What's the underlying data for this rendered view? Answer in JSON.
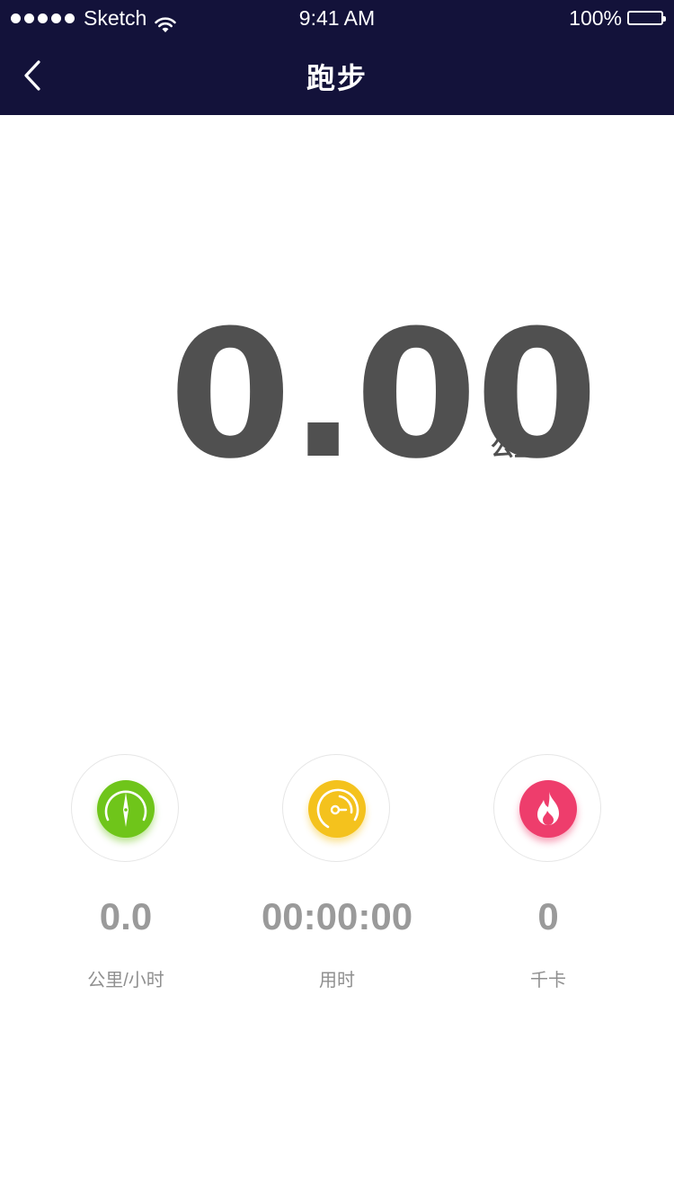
{
  "status_bar": {
    "carrier": "Sketch",
    "time": "9:41 AM",
    "battery": "100%",
    "signal_dots": 5
  },
  "nav": {
    "title": "跑步",
    "back_icon": "chevron-left-icon"
  },
  "distance": {
    "value": "0.00",
    "unit": "公里"
  },
  "stats": [
    {
      "value": "0.0",
      "label": "公里/小时",
      "icon": "compass-icon",
      "color": "#6fc51a"
    },
    {
      "value": "00:00:00",
      "label": "用时",
      "icon": "speedometer-icon",
      "color": "#f4c21d"
    },
    {
      "value": "0",
      "label": "千卡",
      "icon": "flame-icon",
      "color": "#ee3d6c"
    }
  ],
  "colors": {
    "header_bg": "#13123a",
    "primary_text": "#505050",
    "secondary_text": "#9a9a9a"
  }
}
